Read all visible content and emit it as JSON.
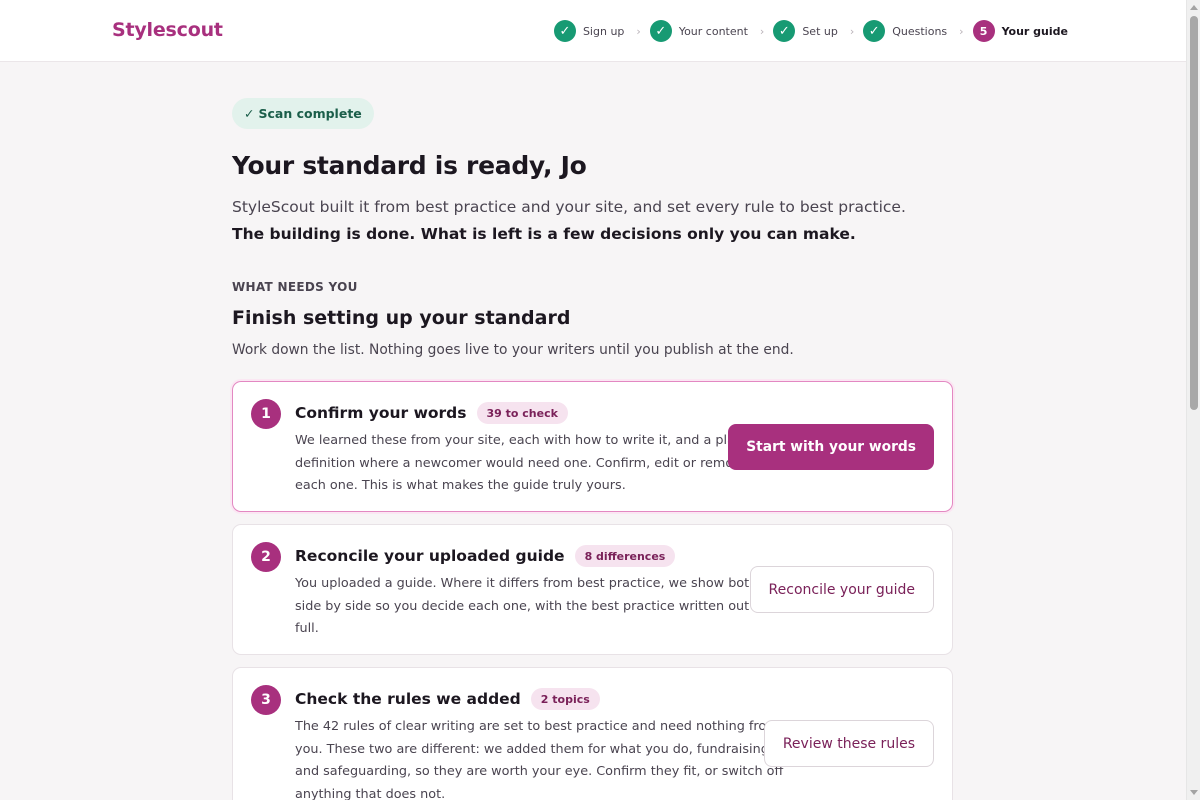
{
  "brand": "Stylescout",
  "steps": [
    {
      "label": "Sign up",
      "status": "done",
      "glyph": "✓"
    },
    {
      "label": "Your content",
      "status": "done",
      "glyph": "✓"
    },
    {
      "label": "Set up",
      "status": "done",
      "glyph": "✓"
    },
    {
      "label": "Questions",
      "status": "done",
      "glyph": "✓"
    },
    {
      "label": "Your guide",
      "status": "current",
      "glyph": "5"
    }
  ],
  "step_separator": "›",
  "status_badge": {
    "icon": "✓",
    "label": "Scan complete"
  },
  "page_title": "Your standard is ready, Jo",
  "intro": {
    "plain": "StyleScout built it from best practice and your site, and set every rule to best practice.",
    "bold": "The building is done. What is left is a few decisions only you can make."
  },
  "kicker": "WHAT NEEDS YOU",
  "section_title": "Finish setting up your standard",
  "section_sub": "Work down the list. Nothing goes live to your writers until you publish at the end.",
  "tasks": [
    {
      "number": "1",
      "title": "Confirm your words",
      "badge": "39 to check",
      "lines": [
        "We learned these from your site, each with how to write it, and a plain",
        "definition where a newcomer would need one. Confirm, edit or remove",
        "each one. This is what makes the guide truly yours."
      ],
      "action": "Start with your words"
    },
    {
      "number": "2",
      "title": "Reconcile your uploaded guide",
      "badge": "8 differences",
      "lines": [
        "You uploaded a guide. Where it differs from best practice, we show both",
        "side by side so you decide each one, with the best practice written out in",
        "full."
      ],
      "action": "Reconcile your guide"
    },
    {
      "number": "3",
      "title": "Check the rules we added",
      "badge": "2 topics",
      "lines": [
        "The 42 rules of clear writing are set to best practice and need nothing from",
        "you. These two are different: we added them for what you do, fundraising",
        "and safeguarding, so they are worth your eye. Confirm they fit, or switch off",
        "anything that does not."
      ],
      "action": "Review these rules"
    }
  ],
  "colors": {
    "brand": "#a8307e",
    "done": "#179a73",
    "badge_bg": "#f6e3ef",
    "page_bg": "#f7f5f6"
  }
}
